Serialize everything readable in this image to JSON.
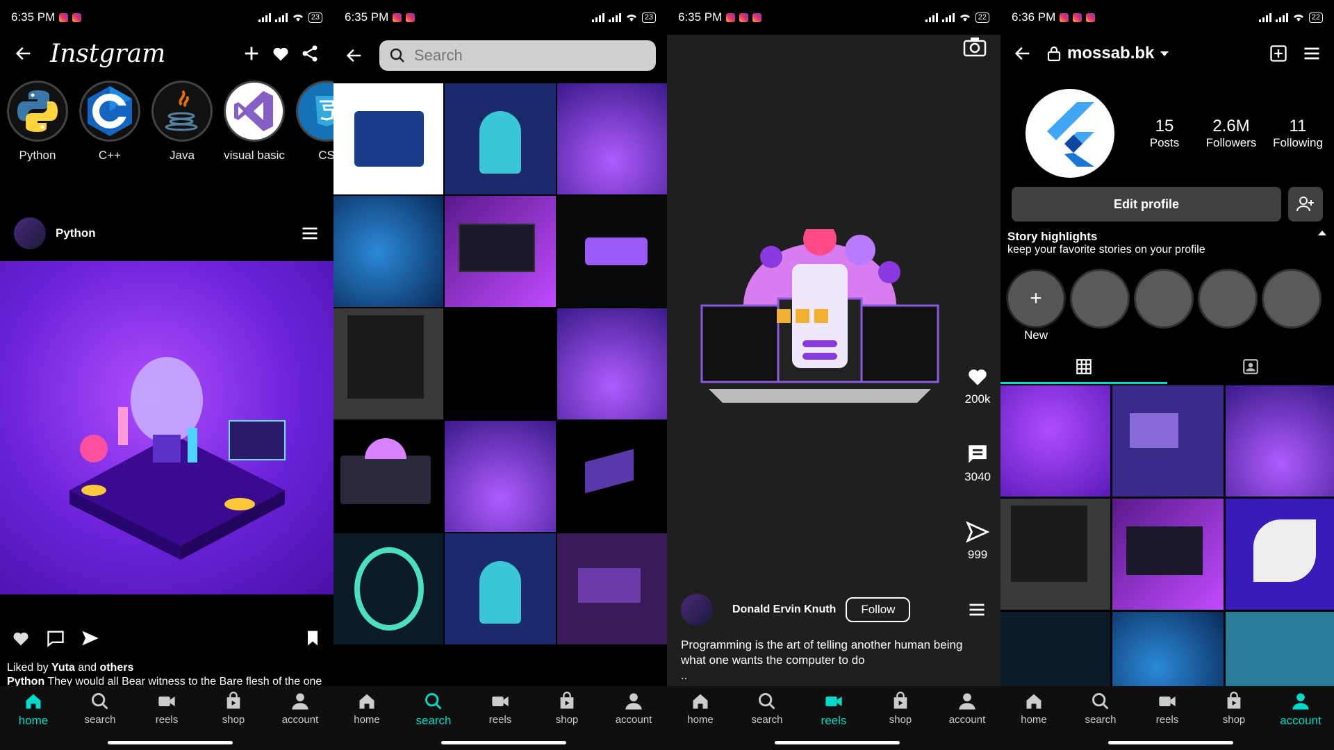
{
  "screen1": {
    "status": {
      "time": "6:35 PM",
      "battery": "23"
    },
    "brand": "Instgram",
    "stories": [
      {
        "label": "Python"
      },
      {
        "label": "C++"
      },
      {
        "label": "Java"
      },
      {
        "label": "visual basic"
      },
      {
        "label": "CS"
      }
    ],
    "post": {
      "username": "Python",
      "liked_prefix": "Liked by ",
      "liked_user": "Yuta",
      "liked_mid": " and ",
      "liked_others": "others",
      "caption_user": "Python",
      "caption_text": "  They would all Bear witness to the Bare flesh of the one who is free"
    }
  },
  "screen2": {
    "status": {
      "time": "6:35 PM",
      "battery": "23"
    },
    "search_placeholder": "Search"
  },
  "screen3": {
    "status": {
      "time": "6:35 PM",
      "battery": "22"
    },
    "likes": "200k",
    "comments": "3040",
    "shares": "999",
    "username": "Donald Ervin Knuth",
    "follow_label": "Follow",
    "caption": "Programming is the art of telling another human being what one wants the computer to do",
    "caption_more": ".."
  },
  "screen4": {
    "status": {
      "time": "6:36 PM",
      "battery": "22"
    },
    "username": "mossab.bk",
    "posts_count": "15",
    "posts_label": "Posts",
    "followers_count": "2.6M",
    "followers_label": "Followers",
    "following_count": "11",
    "following_label": "Following",
    "edit_profile_label": "Edit profile",
    "highlights_title": "Story highlights",
    "highlights_sub": "keep your favorite stories on your profile",
    "new_label": "New"
  },
  "nav": {
    "home": "home",
    "search": "search",
    "reels": "reels",
    "shop": "shop",
    "account": "account"
  },
  "colors": {
    "accent": "#00d9c7"
  }
}
